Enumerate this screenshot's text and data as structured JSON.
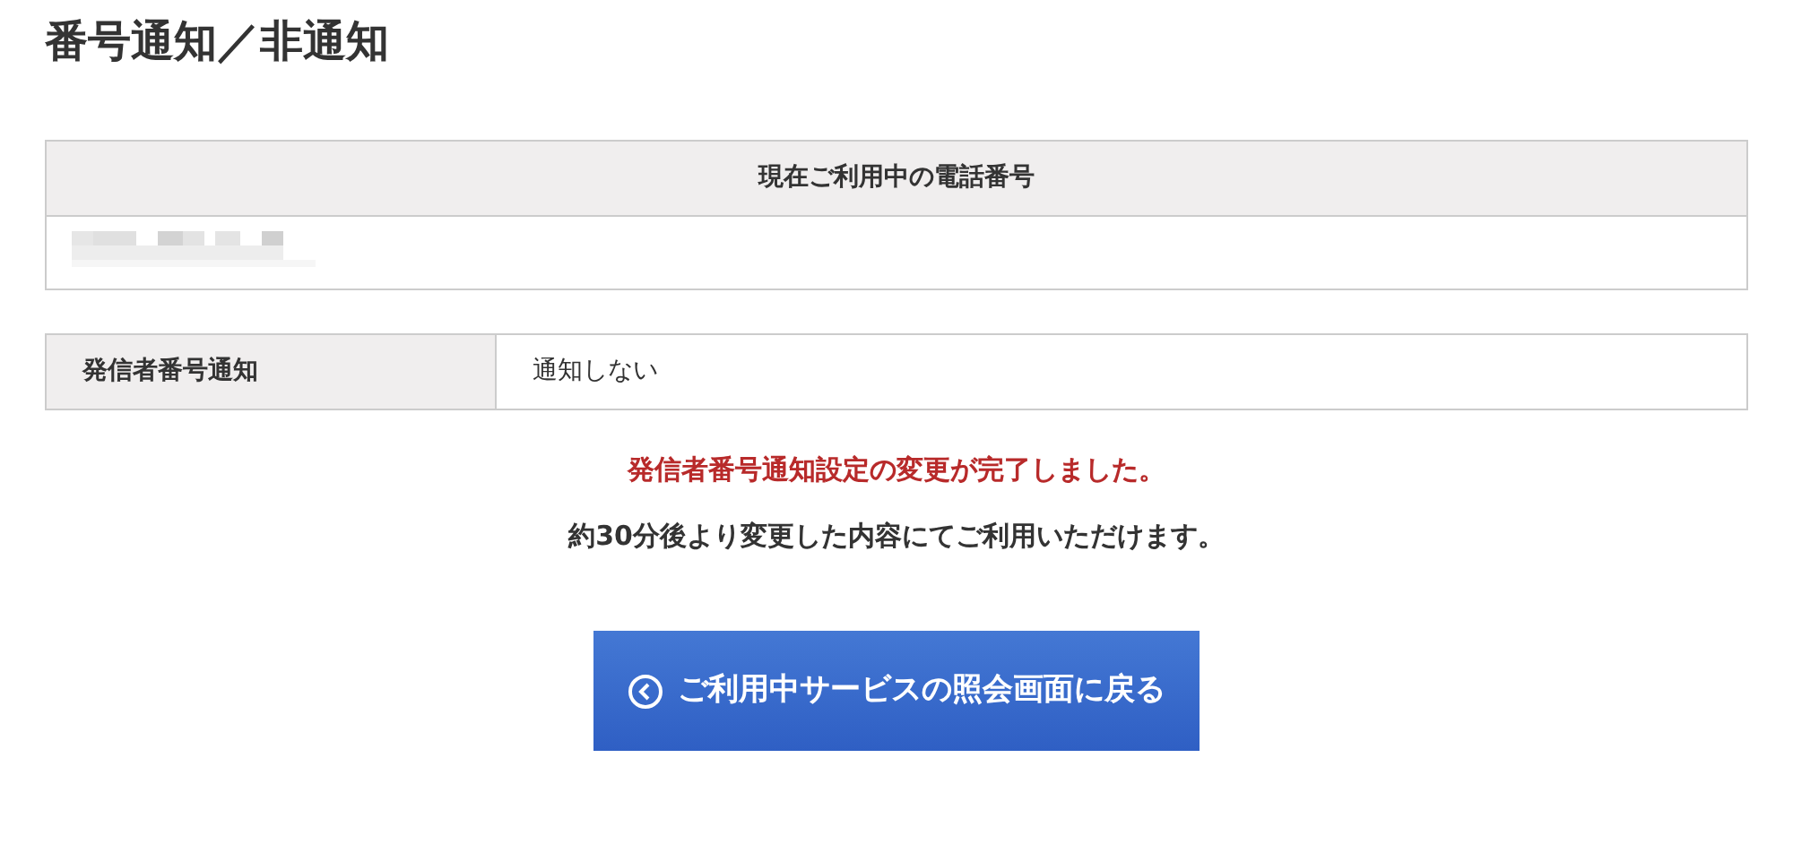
{
  "page": {
    "title": "番号通知／非通知"
  },
  "phone_table": {
    "header": "現在ご利用中の電話番号",
    "value_redacted": true
  },
  "settings_table": {
    "rows": [
      {
        "label": "発信者番号通知",
        "value": "通知しない"
      }
    ]
  },
  "messages": [
    {
      "kind": "success",
      "text": "発信者番号通知設定の変更が完了しました。"
    },
    {
      "kind": "info",
      "text": "約30分後より変更した内容にてご利用いただけます。"
    }
  ],
  "back_button": {
    "label": "ご利用中サービスの照会画面に戻る"
  }
}
